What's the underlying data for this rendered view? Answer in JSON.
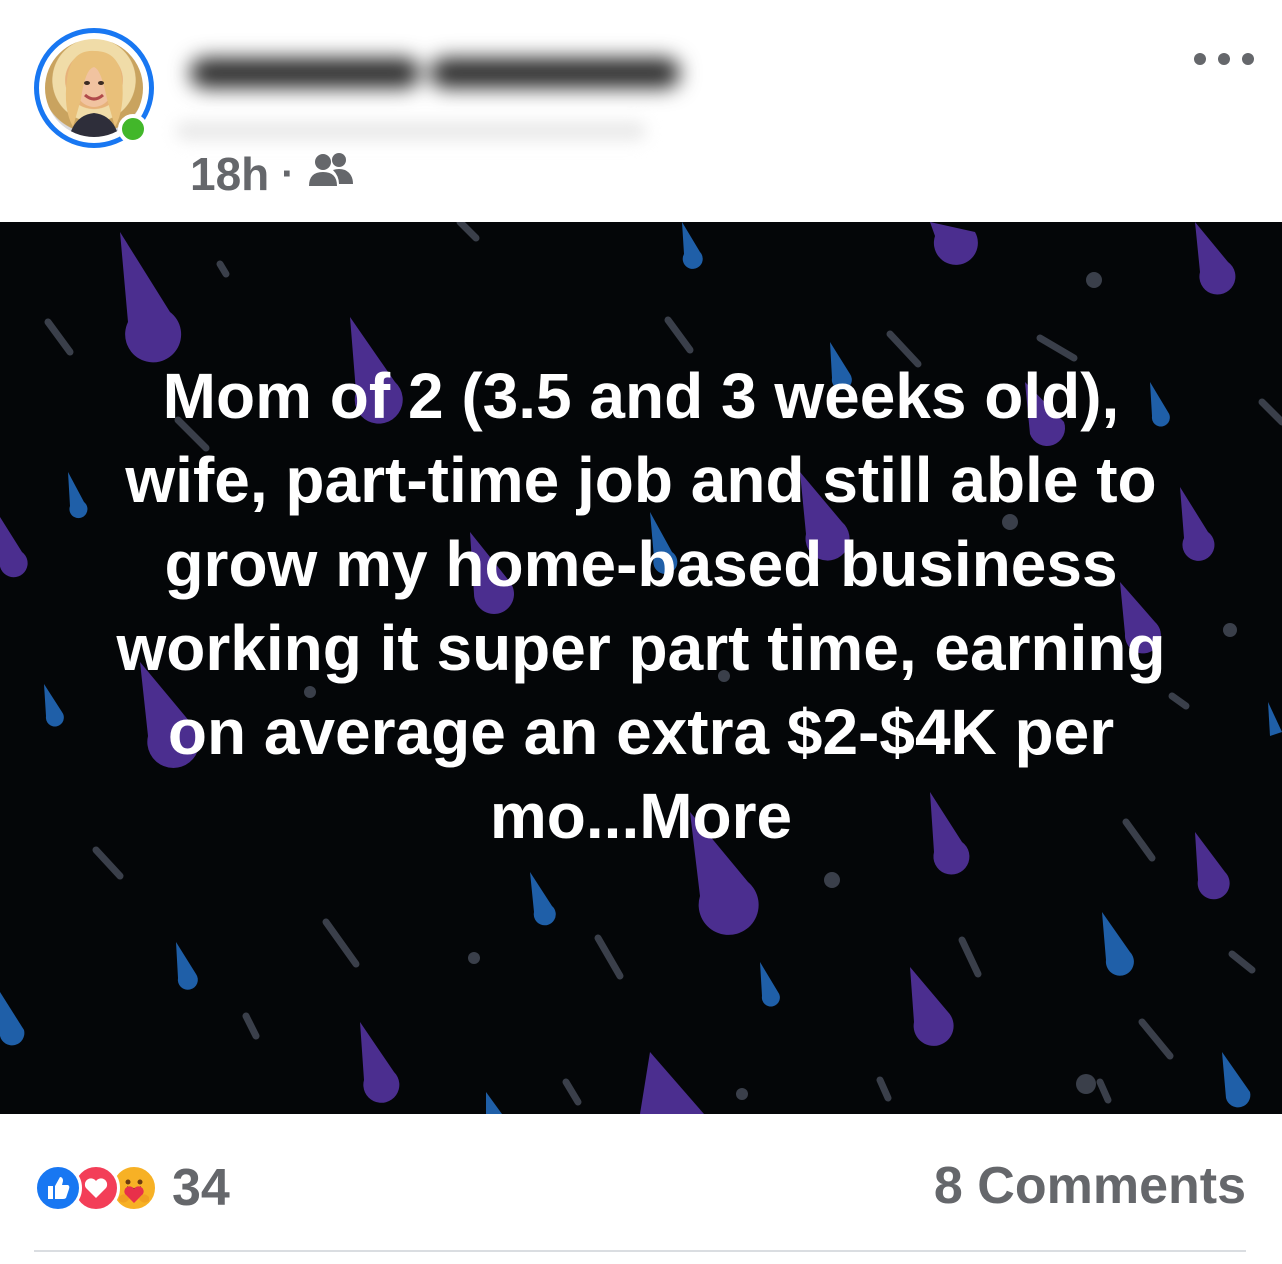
{
  "post": {
    "author_name": "",
    "time": "18h",
    "separator": "·",
    "audience_icon": "friends-icon",
    "more_icon": "more-options-icon",
    "text": "Mom of 2 (3.5 and 3 weeks old), wife, part-time job and still able to grow my home-based business working it super part time, earning on average an extra $2-$4K per mo...",
    "more_label": "More",
    "background_color": "#040608",
    "drop_colors": [
      "#4b2e8f",
      "#1f5fa8",
      "#3a3f4a"
    ]
  },
  "footer": {
    "reaction_icons": [
      "like-icon",
      "love-icon",
      "care-icon"
    ],
    "reaction_count": "34",
    "comments_label": "8 Comments"
  },
  "colors": {
    "accent": "#1877f2",
    "online": "#42b72a",
    "meta_text": "#65676b"
  }
}
